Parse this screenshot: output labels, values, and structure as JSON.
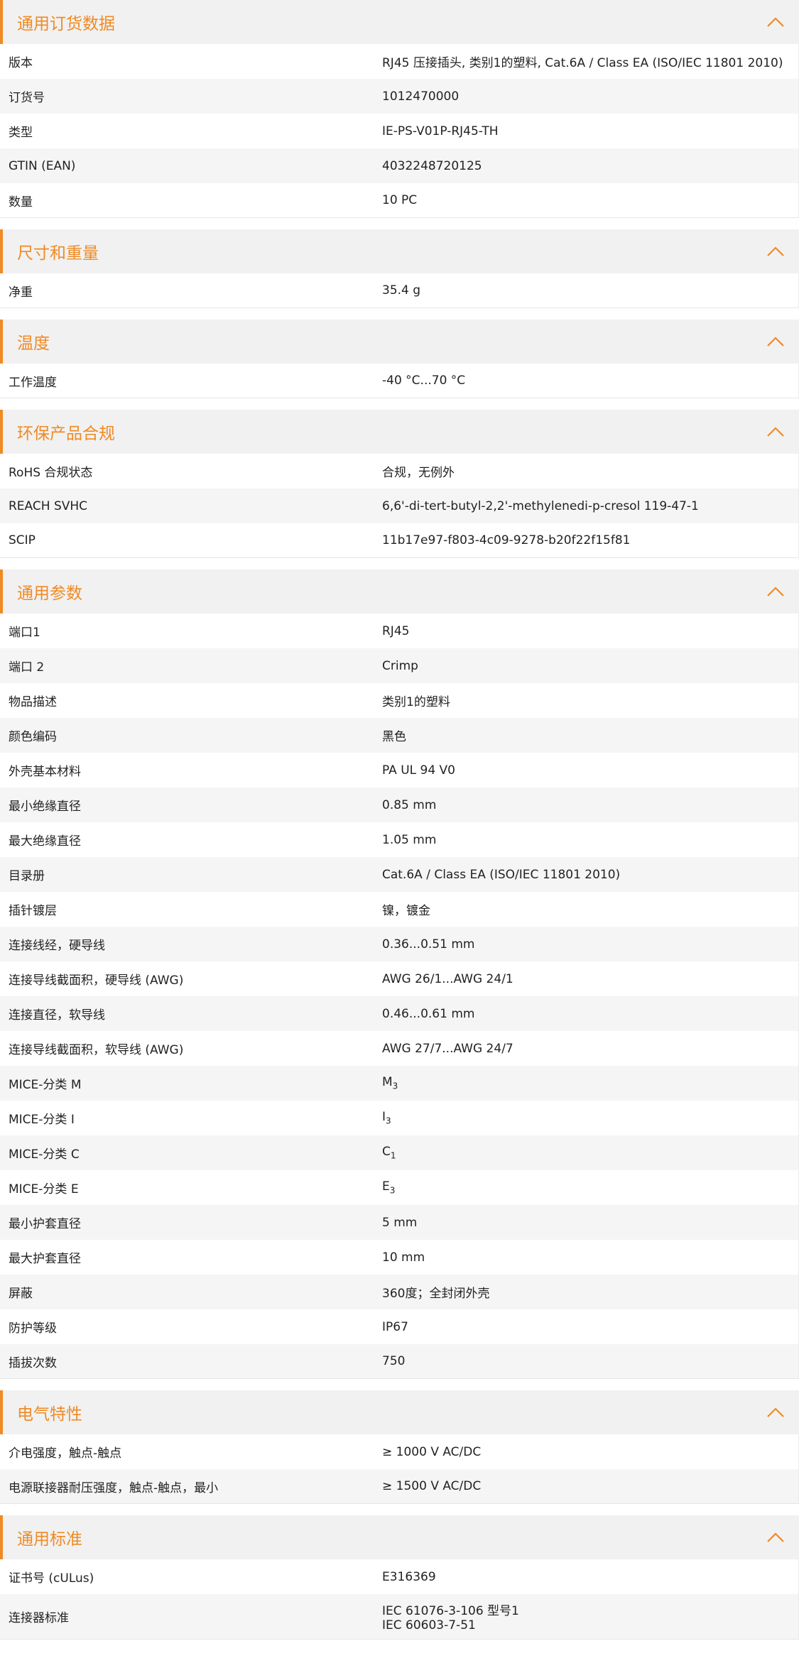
{
  "colors": {
    "accent": "#f08a24",
    "header_bg": "#f1f1f1",
    "row_alt": "#f5f5f5"
  },
  "sections": [
    {
      "title": "通用订货数据",
      "rows": [
        {
          "label": "版本",
          "value": "RJ45 压接插头, 类别1的塑料, Cat.6A / Class EA (ISO/IEC 11801 2010)"
        },
        {
          "label": "订货号",
          "value": "1012470000"
        },
        {
          "label": "类型",
          "value": "IE-PS-V01P-RJ45-TH"
        },
        {
          "label": "GTIN (EAN)",
          "value": "4032248720125"
        },
        {
          "label": "数量",
          "value": "10  PC"
        }
      ]
    },
    {
      "title": "尺寸和重量",
      "rows": [
        {
          "label": "净重",
          "value": "35.4  g"
        }
      ]
    },
    {
      "title": "温度",
      "rows": [
        {
          "label": "工作温度",
          "value": "-40 °C...70 °C"
        }
      ]
    },
    {
      "title": "环保产品合规",
      "rows": [
        {
          "label": "RoHS 合规状态",
          "value": "合规，无例外"
        },
        {
          "label": "REACH SVHC",
          "value": "6,6'-di-tert-butyl-2,2'-methylenedi-p-cresol 119-47-1"
        },
        {
          "label": "SCIP",
          "value": "11b17e97-f803-4c09-9278-b20f22f15f81"
        }
      ]
    },
    {
      "title": "通用参数",
      "rows": [
        {
          "label": "端口1",
          "value": "RJ45"
        },
        {
          "label": "端口 2",
          "value": "Crimp"
        },
        {
          "label": "物品描述",
          "value": "类别1的塑料"
        },
        {
          "label": "颜色编码",
          "value": "黑色"
        },
        {
          "label": "外壳基本材料",
          "value": "PA UL 94 V0"
        },
        {
          "label": "最小绝缘直径",
          "value": "0.85  mm"
        },
        {
          "label": "最大绝缘直径",
          "value": "1.05  mm"
        },
        {
          "label": "目录册",
          "value": "Cat.6A / Class EA (ISO/IEC 11801 2010)"
        },
        {
          "label": "插针镀层",
          "value": "镍，镀金"
        },
        {
          "label": "连接线经，硬导线",
          "value": "0.36...0.51 mm"
        },
        {
          "label": "连接导线截面积，硬导线 (AWG)",
          "value": "AWG 26/1...AWG 24/1"
        },
        {
          "label": "连接直径，软导线",
          "value": "0.46...0.61 mm"
        },
        {
          "label": "连接导线截面积，软导线 (AWG)",
          "value": "AWG 27/7...AWG 24/7"
        },
        {
          "label": "MICE-分类 M",
          "value": "M",
          "sub": "3"
        },
        {
          "label": "MICE-分类 I",
          "value": "I",
          "sub": "3"
        },
        {
          "label": "MICE-分类 C",
          "value": "C",
          "sub": "1"
        },
        {
          "label": "MICE-分类 E",
          "value": "E",
          "sub": "3"
        },
        {
          "label": "最小护套直径",
          "value": "5  mm"
        },
        {
          "label": "最大护套直径",
          "value": "10  mm"
        },
        {
          "label": "屏蔽",
          "value": "360度；全封闭外壳"
        },
        {
          "label": "防护等级",
          "value": "IP67"
        },
        {
          "label": "插拔次数",
          "value": "750"
        }
      ]
    },
    {
      "title": "电气特性",
      "rows": [
        {
          "label": "介电强度，触点-触点",
          "value": "≥ 1000 V AC/DC"
        },
        {
          "label": "电源联接器耐压强度，触点-触点，最小",
          "value": "≥ 1500 V AC/DC"
        }
      ]
    },
    {
      "title": "通用标准",
      "rows": [
        {
          "label": "证书号 (cULus)",
          "value": "E316369"
        },
        {
          "label": "连接器标准",
          "value": "IEC 61076-3-106 型号1",
          "value2": "IEC 60603-7-51"
        }
      ]
    }
  ]
}
